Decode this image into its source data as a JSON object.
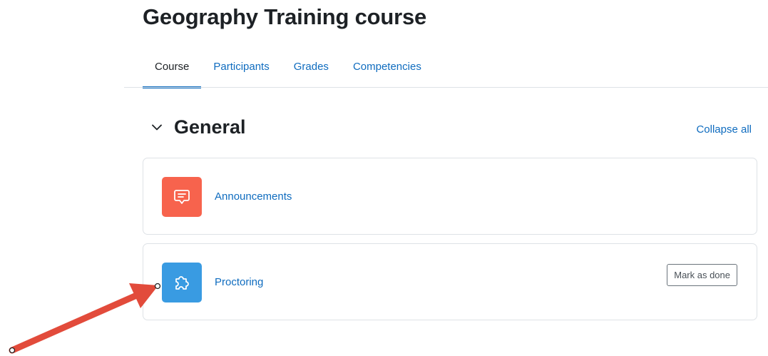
{
  "course": {
    "title": "Geography Training course"
  },
  "tabs": [
    {
      "label": "Course",
      "active": true
    },
    {
      "label": "Participants",
      "active": false
    },
    {
      "label": "Grades",
      "active": false
    },
    {
      "label": "Competencies",
      "active": false
    }
  ],
  "section": {
    "title": "General",
    "collapse_label": "Collapse all"
  },
  "activities": [
    {
      "name": "Announcements",
      "icon": "forum-icon",
      "icon_color": "#f7634d"
    },
    {
      "name": "Proctoring",
      "icon": "puzzle-piece-icon",
      "icon_color": "#399be2",
      "completion_button": "Mark as done"
    }
  ],
  "colors": {
    "accent": "#0f6cbf",
    "annotation_arrow": "#e24b3b"
  }
}
